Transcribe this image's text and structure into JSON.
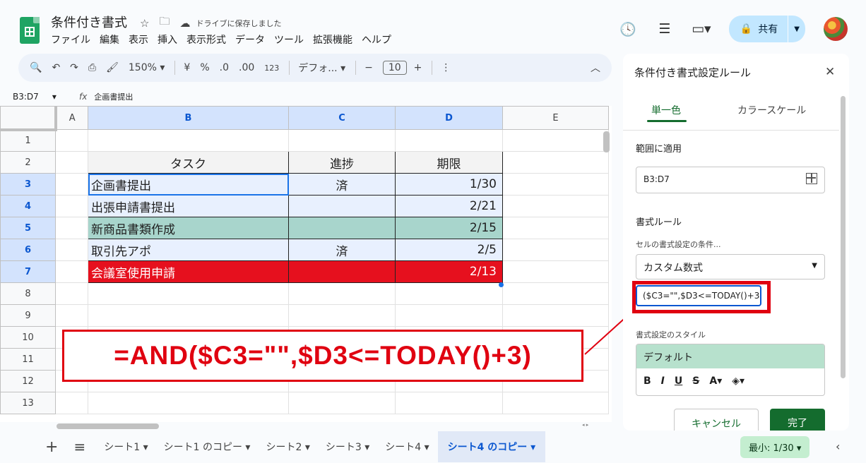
{
  "header": {
    "doc_title": "条件付き書式",
    "save_status": "ドライブに保存しました",
    "menu": [
      "ファイル",
      "編集",
      "表示",
      "挿入",
      "表示形式",
      "データ",
      "ツール",
      "拡張機能",
      "ヘルプ"
    ],
    "share_label": "共有"
  },
  "toolbar": {
    "zoom": "150%",
    "currency": "¥",
    "percent": "%",
    "dec_minus": ".0",
    "dec_plus": ".00",
    "number_format": "123",
    "font": "デフォ...",
    "font_size": "10"
  },
  "formula_bar": {
    "name_box": "B3:D7",
    "fx": "fx",
    "value": "企画書提出"
  },
  "sheet": {
    "columns": [
      "A",
      "B",
      "C",
      "D",
      "E"
    ],
    "rows": [
      "1",
      "2",
      "3",
      "4",
      "5",
      "6",
      "7",
      "8",
      "9",
      "10",
      "11",
      "12",
      "13"
    ],
    "headers": {
      "task": "タスク",
      "progress": "進捗",
      "due": "期限"
    },
    "data": [
      {
        "task": "企画書提出",
        "progress": "済",
        "due": "1/30"
      },
      {
        "task": "出張申請書提出",
        "progress": "",
        "due": "2/21"
      },
      {
        "task": "新商品書類作成",
        "progress": "",
        "due": "2/15"
      },
      {
        "task": "取引先アポ",
        "progress": "済",
        "due": "2/5"
      },
      {
        "task": "会議室使用申請",
        "progress": "",
        "due": "2/13"
      }
    ],
    "colors": {
      "selected": "#e8f0fe",
      "green": "#a8d5cc",
      "red": "#e6101e"
    }
  },
  "annotation": {
    "formula": "=AND($C3=\"\",$D3<=TODAY()+3)",
    "color": "#e00010"
  },
  "bottom_bar": {
    "tabs": [
      "シート1",
      "シート1 のコピー",
      "シート2",
      "シート3",
      "シート4",
      "シート4 のコピー"
    ],
    "active_tab": "シート4 のコピー",
    "stat": "最小: 1/30"
  },
  "panel": {
    "title": "条件付き書式設定ルール",
    "tab_single": "単一色",
    "tab_scale": "カラースケール",
    "range_label": "範囲に適用",
    "range_value": "B3:D7",
    "rules_label": "書式ルール",
    "condition_label": "セルの書式設定の条件...",
    "condition_value": "カスタム数式",
    "formula_value": "($C3=\"\",$D3<=TODAY()+3)",
    "style_label": "書式設定のスタイル",
    "style_preview": "デフォルト",
    "cancel_label": "キャンセル",
    "done_label": "完了"
  }
}
